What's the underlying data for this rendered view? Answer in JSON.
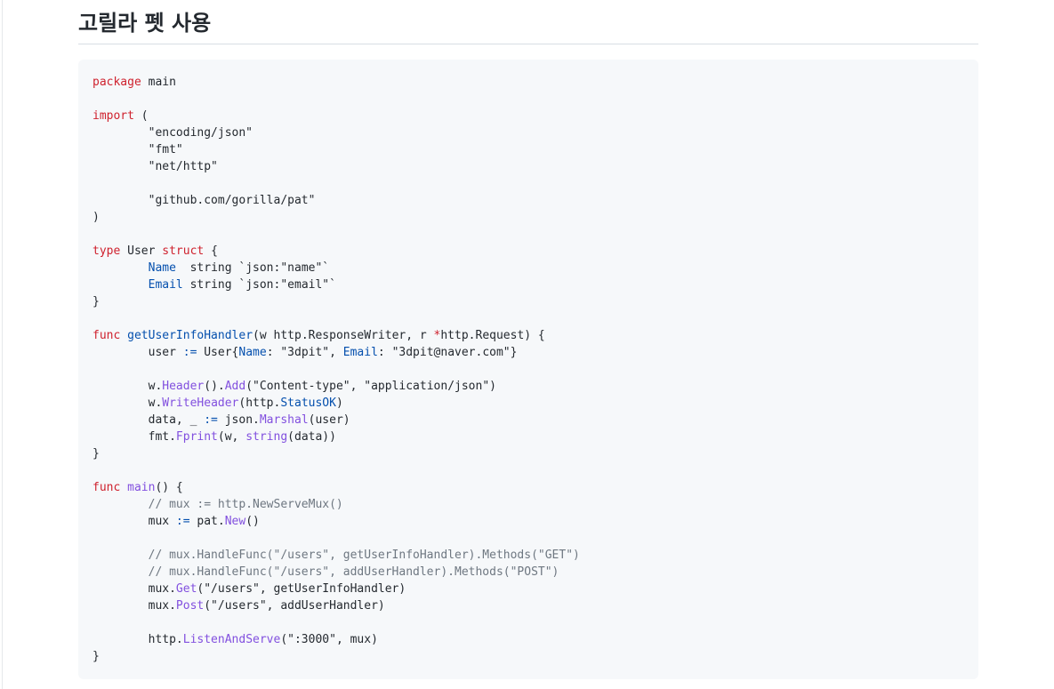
{
  "heading": {
    "title": "고릴라 펫 사용"
  },
  "code": {
    "language": "go",
    "colors": {
      "keyword": "#cf222e",
      "function": "#8250df",
      "field": "#0550ae",
      "comment": "#6e7781",
      "text": "#24292f",
      "background": "#f6f8fa"
    },
    "lines": [
      [
        [
          "k",
          "package"
        ],
        [
          "t",
          " main"
        ]
      ],
      [],
      [
        [
          "k",
          "import"
        ],
        [
          "t",
          " ("
        ]
      ],
      [
        [
          "t",
          "        \"encoding/json\""
        ]
      ],
      [
        [
          "t",
          "        \"fmt\""
        ]
      ],
      [
        [
          "t",
          "        \"net/http\""
        ]
      ],
      [],
      [
        [
          "t",
          "        \"github.com/gorilla/pat\""
        ]
      ],
      [
        [
          "t",
          ")"
        ]
      ],
      [],
      [
        [
          "k",
          "type"
        ],
        [
          "t",
          " User "
        ],
        [
          "k",
          "struct"
        ],
        [
          "t",
          " {"
        ]
      ],
      [
        [
          "t",
          "        "
        ],
        [
          "n",
          "Name"
        ],
        [
          "t",
          "  string `json:\"name\"`"
        ]
      ],
      [
        [
          "t",
          "        "
        ],
        [
          "n",
          "Email"
        ],
        [
          "t",
          " string `json:\"email\"`"
        ]
      ],
      [
        [
          "t",
          "}"
        ]
      ],
      [],
      [
        [
          "k",
          "func"
        ],
        [
          "t",
          " "
        ],
        [
          "n",
          "getUserInfoHandler"
        ],
        [
          "t",
          "(w http.ResponseWriter, r "
        ],
        [
          "k",
          "*"
        ],
        [
          "t",
          "http.Request) {"
        ]
      ],
      [
        [
          "t",
          "        user "
        ],
        [
          "n",
          ":="
        ],
        [
          "t",
          " User{"
        ],
        [
          "n",
          "Name"
        ],
        [
          "t",
          ": \"3dpit\", "
        ],
        [
          "n",
          "Email"
        ],
        [
          "t",
          ": \"3dpit@naver.com\"}"
        ]
      ],
      [],
      [
        [
          "t",
          "        w."
        ],
        [
          "f",
          "Header"
        ],
        [
          "t",
          "()."
        ],
        [
          "f",
          "Add"
        ],
        [
          "t",
          "(\"Content-type\", \"application/json\")"
        ]
      ],
      [
        [
          "t",
          "        w."
        ],
        [
          "f",
          "WriteHeader"
        ],
        [
          "t",
          "(http."
        ],
        [
          "n",
          "StatusOK"
        ],
        [
          "t",
          ")"
        ]
      ],
      [
        [
          "t",
          "        data, _ "
        ],
        [
          "n",
          ":="
        ],
        [
          "t",
          " json."
        ],
        [
          "f",
          "Marshal"
        ],
        [
          "t",
          "(user)"
        ]
      ],
      [
        [
          "t",
          "        fmt."
        ],
        [
          "f",
          "Fprint"
        ],
        [
          "t",
          "(w, "
        ],
        [
          "f",
          "string"
        ],
        [
          "t",
          "(data))"
        ]
      ],
      [
        [
          "t",
          "}"
        ]
      ],
      [],
      [
        [
          "k",
          "func"
        ],
        [
          "t",
          " "
        ],
        [
          "f",
          "main"
        ],
        [
          "t",
          "() {"
        ]
      ],
      [
        [
          "c",
          "        // mux := http.NewServeMux()"
        ]
      ],
      [
        [
          "t",
          "        mux "
        ],
        [
          "n",
          ":="
        ],
        [
          "t",
          " pat."
        ],
        [
          "f",
          "New"
        ],
        [
          "t",
          "()"
        ]
      ],
      [],
      [
        [
          "c",
          "        // mux.HandleFunc(\"/users\", getUserInfoHandler).Methods(\"GET\")"
        ]
      ],
      [
        [
          "c",
          "        // mux.HandleFunc(\"/users\", addUserHandler).Methods(\"POST\")"
        ]
      ],
      [
        [
          "t",
          "        mux."
        ],
        [
          "f",
          "Get"
        ],
        [
          "t",
          "(\"/users\", getUserInfoHandler)"
        ]
      ],
      [
        [
          "t",
          "        mux."
        ],
        [
          "f",
          "Post"
        ],
        [
          "t",
          "(\"/users\", addUserHandler)"
        ]
      ],
      [],
      [
        [
          "t",
          "        http."
        ],
        [
          "f",
          "ListenAndServe"
        ],
        [
          "t",
          "(\":3000\", mux)"
        ]
      ],
      [
        [
          "t",
          "}"
        ]
      ]
    ]
  }
}
